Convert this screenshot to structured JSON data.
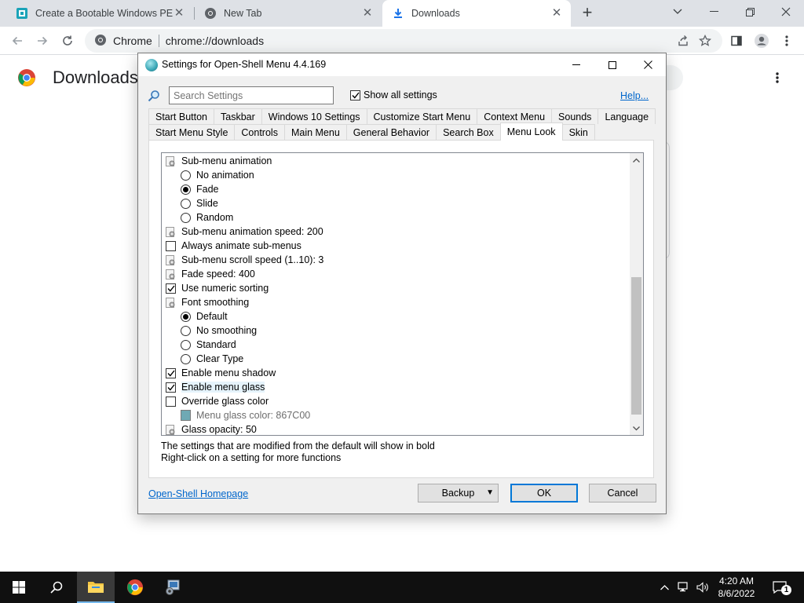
{
  "browser": {
    "tabs": [
      {
        "title": "Create a Bootable Windows PE D",
        "icon": "site-favicon-icon"
      },
      {
        "title": "New Tab",
        "icon": "chrome-icon"
      },
      {
        "title": "Downloads",
        "icon": "download-icon"
      }
    ],
    "omnibox": {
      "chip": "Chrome",
      "url": "chrome://downloads"
    }
  },
  "downloads_page": {
    "title": "Downloads"
  },
  "dialog": {
    "title": "Settings for Open-Shell Menu 4.4.169",
    "search_placeholder": "Search Settings",
    "show_all_label": "Show all settings",
    "help_label": "Help...",
    "tabs_row1": [
      "Start Button",
      "Taskbar",
      "Windows 10 Settings",
      "Customize Start Menu",
      "Context Menu",
      "Sounds",
      "Language"
    ],
    "tabs_row2": [
      "Start Menu Style",
      "Controls",
      "Main Menu",
      "General Behavior",
      "Search Box",
      "Menu Look",
      "Skin"
    ],
    "active_tab": "Menu Look",
    "settings": [
      {
        "type": "gear",
        "label": "Sub-menu animation"
      },
      {
        "type": "radio",
        "label": "No animation",
        "checked": false
      },
      {
        "type": "radio",
        "label": "Fade",
        "checked": true
      },
      {
        "type": "radio",
        "label": "Slide",
        "checked": false
      },
      {
        "type": "radio",
        "label": "Random",
        "checked": false
      },
      {
        "type": "gear",
        "label": "Sub-menu animation speed: 200"
      },
      {
        "type": "checkbox",
        "label": "Always animate sub-menus",
        "checked": false
      },
      {
        "type": "gear",
        "label": "Sub-menu scroll speed (1..10): 3"
      },
      {
        "type": "gear",
        "label": "Fade speed: 400"
      },
      {
        "type": "checkbox",
        "label": "Use numeric sorting",
        "checked": true
      },
      {
        "type": "gear",
        "label": "Font smoothing"
      },
      {
        "type": "radio",
        "label": "Default",
        "checked": true
      },
      {
        "type": "radio",
        "label": "No smoothing",
        "checked": false
      },
      {
        "type": "radio",
        "label": "Standard",
        "checked": false
      },
      {
        "type": "radio",
        "label": "Clear Type",
        "checked": false
      },
      {
        "type": "checkbox",
        "label": "Enable menu shadow",
        "checked": true
      },
      {
        "type": "checkbox",
        "label": "Enable menu glass",
        "checked": true,
        "highlighted": true
      },
      {
        "type": "checkbox",
        "label": "Override glass color",
        "checked": false
      },
      {
        "type": "color",
        "label": "Menu glass color: 867C00",
        "swatch": "#6fa9b4",
        "disabled": true
      },
      {
        "type": "gear",
        "label": "Glass opacity: 50"
      }
    ],
    "note_line1": "The settings that are modified from the default will show in bold",
    "note_line2": "Right-click on a setting for more functions",
    "homepage_label": "Open-Shell Homepage",
    "backup_label": "Backup",
    "ok_label": "OK",
    "cancel_label": "Cancel"
  },
  "taskbar": {
    "time": "4:20 AM",
    "date": "8/6/2022",
    "notifications": "1"
  },
  "colors": {
    "link": "#0066cc",
    "taskbar": "#101010",
    "ok_border": "#0078d7"
  }
}
